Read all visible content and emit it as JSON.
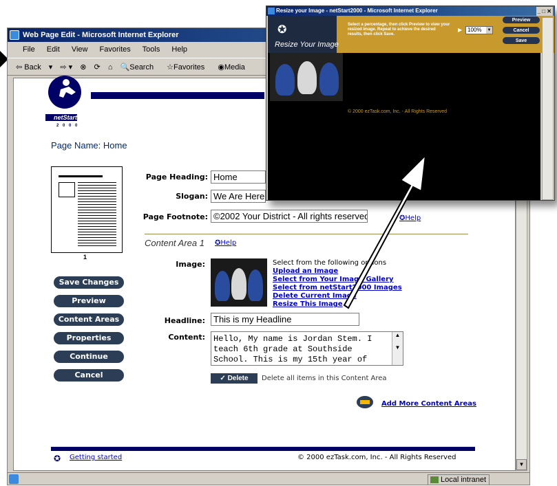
{
  "main_window": {
    "title": "Web Page Edit - Microsoft Internet Explorer",
    "menu": [
      "File",
      "Edit",
      "View",
      "Favorites",
      "Tools",
      "Help"
    ],
    "toolbar": {
      "back": "Back",
      "search": "Search",
      "favorites": "Favorites",
      "media": "Media"
    },
    "status": {
      "zone": "Local intranet"
    }
  },
  "page": {
    "logo_text": "netStart",
    "logo_sub": "2 0 0 0",
    "page_name_label": "Page Name:",
    "page_name_value": "Home",
    "thumbnail_page_number": "1",
    "fields": {
      "heading_label": "Page Heading:",
      "heading_value": "Home",
      "slogan_label": "Slogan:",
      "slogan_value": "We Are Here",
      "footnote_label": "Page Footnote:",
      "footnote_value": "©2002 Your District - All rights reserved.",
      "footnote_help": "Help"
    },
    "content_area": {
      "title": "Content Area 1",
      "help": "Help",
      "image_label": "Image:",
      "select_text": "Select from the following options",
      "options": [
        "Upload an Image",
        "Select from Your Image Gallery",
        "Select from netStart2000 Images",
        "Delete Current Image",
        "Resize This Image"
      ],
      "headline_label": "Headline:",
      "headline_value": "This is my Headline",
      "content_label": "Content:",
      "content_value": "Hello, My name is Jordan Stem. I teach 6th grade at Southside School. This is my 15th year of",
      "delete_button": "✓ Delete",
      "delete_text": "Delete all items in this Content Area"
    },
    "add_more": "Add More Content Areas",
    "buttons": [
      "Save Changes",
      "Preview",
      "Content Areas",
      "Properties",
      "Continue",
      "Cancel"
    ],
    "footer_link": "Getting started",
    "footer_copy": "© 2000 ezTask.com, Inc. - All Rights Reserved"
  },
  "popup": {
    "title": "Resize your Image - netStart2000 - Microsoft Internet Explorer",
    "heading": "Resize Your Image",
    "instructions": "Select a percentage, then click Preview to view your resized image. Repeat to achieve the desired results, then click Save.",
    "zoom_value": "100%",
    "buttons": {
      "preview": "Preview",
      "cancel": "Cancel",
      "save": "Save"
    },
    "copyright": "© 2000 ezTask.com, Inc. - All Rights Reserved"
  },
  "colors": {
    "navy": "#000066",
    "button": "#2c3e55",
    "link": "#0000cc",
    "gold": "#c89a2e"
  }
}
